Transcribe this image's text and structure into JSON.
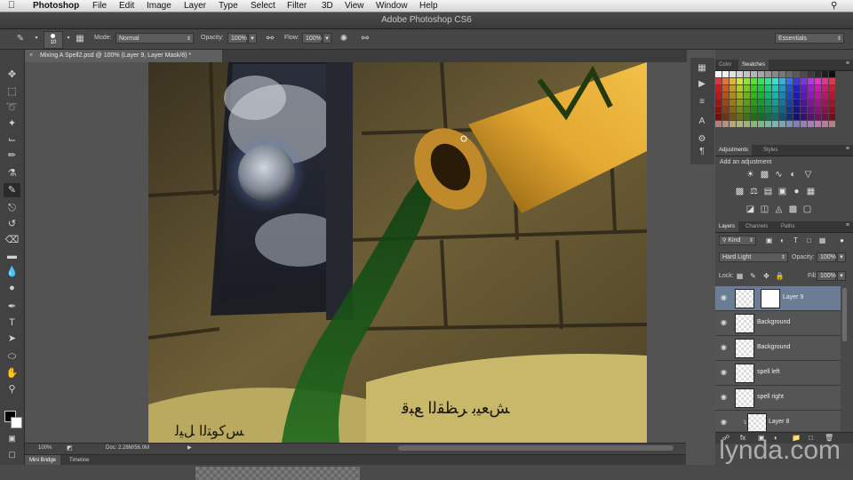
{
  "menubar": {
    "apple": "",
    "app": "Photoshop",
    "items": [
      "File",
      "Edit",
      "Image",
      "Layer",
      "Type",
      "Select",
      "Filter",
      "3D",
      "View",
      "Window",
      "Help"
    ]
  },
  "titlebar": {
    "title": "Adobe Photoshop CS6"
  },
  "options": {
    "brush_size": "10",
    "mode_label": "Mode:",
    "mode_value": "Normal",
    "opacity_label": "Opacity:",
    "opacity_value": "100%",
    "flow_label": "Flow:",
    "flow_value": "100%",
    "workspace": "Essentials"
  },
  "document": {
    "tab_title": "Mixing A Spell2.psd @ 100% (Layer 9, Layer Mask/8) *"
  },
  "status": {
    "zoom": "100%",
    "doc_label": "Doc: 2.28M/56.0M"
  },
  "bottom_tabs": [
    "Mini Bridge",
    "Timeline"
  ],
  "panels": {
    "color_tabs": [
      "Color",
      "Swatches"
    ],
    "adjust_tabs": [
      "Adjustments",
      "Styles"
    ],
    "adjust_title": "Add an adjustment",
    "layers_tabs": [
      "Layers",
      "Channels",
      "Paths"
    ],
    "kind_label": "Kind",
    "blend_mode": "Hard Light",
    "opacity_label": "Opacity:",
    "opacity_value": "100%",
    "lock_label": "Lock:",
    "fill_label": "Fill:",
    "fill_value": "100%"
  },
  "layers": [
    {
      "name": "Layer 9",
      "selected": true
    },
    {
      "name": "Background",
      "selected": false
    },
    {
      "name": "Background",
      "selected": false
    },
    {
      "name": "spell left",
      "selected": false
    },
    {
      "name": "spell right",
      "selected": false
    },
    {
      "name": "Layer 8",
      "selected": false
    }
  ],
  "watermark": "lynda.com",
  "colors": {
    "selected_layer": "#6a7d95",
    "panel_bg": "#494949"
  }
}
